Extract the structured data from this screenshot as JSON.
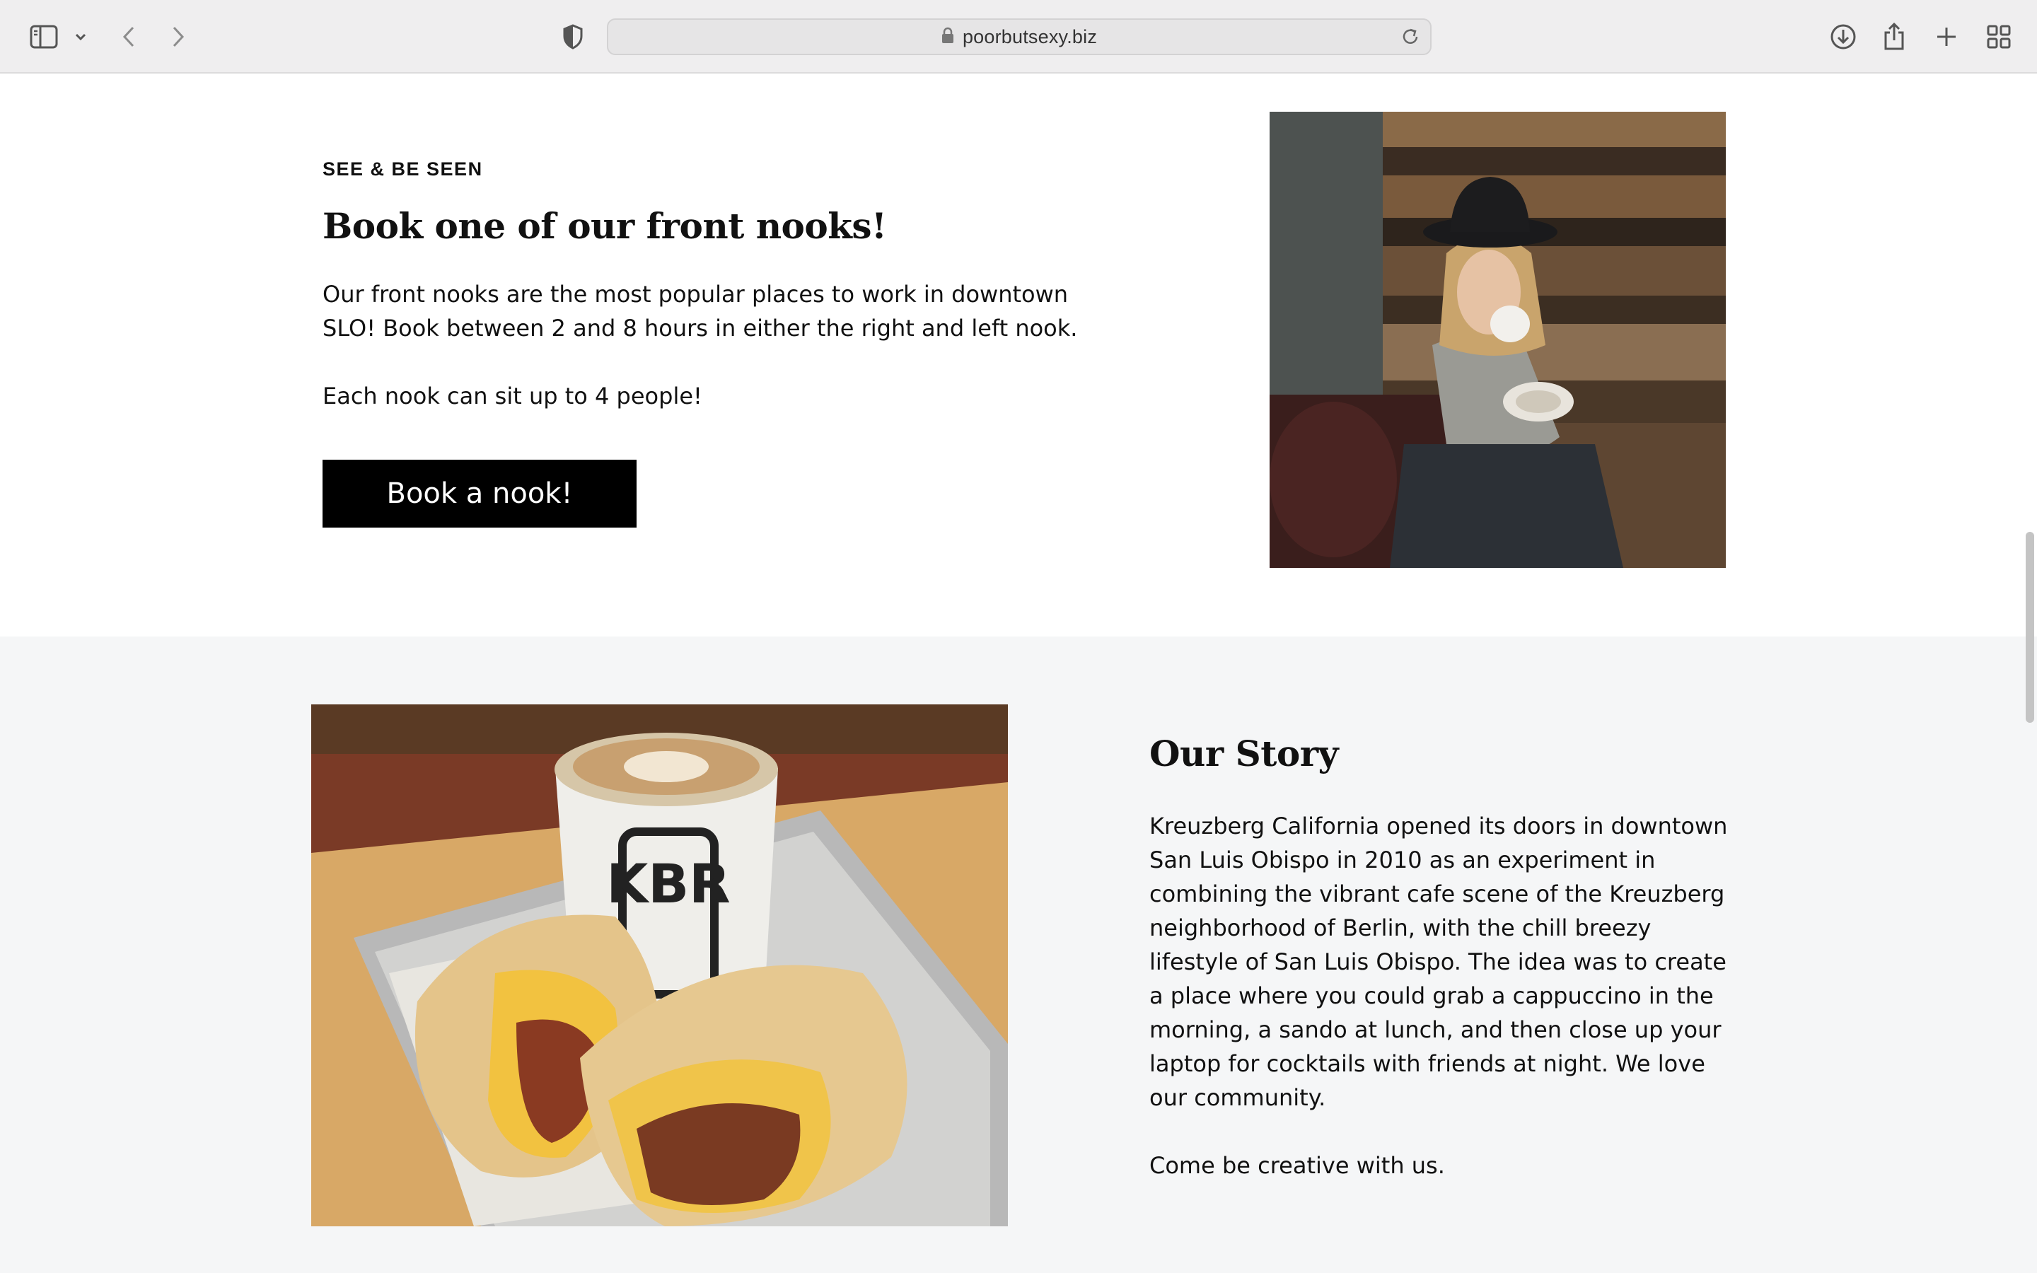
{
  "browser": {
    "url": "poorbutsexy.biz",
    "icons": {
      "sidebar": "sidebar-icon",
      "sidebar_menu": "chevron-down-icon",
      "back": "chevron-left-icon",
      "forward": "chevron-right-icon",
      "privacy": "shield-icon",
      "lock": "lock-icon",
      "reload": "reload-icon",
      "downloads": "download-icon",
      "share": "share-icon",
      "new_tab": "plus-icon",
      "tab_overview": "grid-icon"
    }
  },
  "nook_section": {
    "eyebrow": "SEE & BE SEEN",
    "heading": "Book one of our front nooks!",
    "paragraph1": "Our front nooks are the most popular places to work in downtown SLO! Book between 2 and 8 hours in either the right and left nook.",
    "paragraph2": "Each nook can sit up to 4 people!",
    "button_label": "Book a nook!",
    "image": "photo-woman-drinking-coffee"
  },
  "story_section": {
    "heading": "Our Story",
    "paragraph1": "Kreuzberg California opened its doors in downtown San Luis Obispo in 2010 as an experiment in combining the vibrant cafe scene of the Kreuzberg neighborhood of Berlin, with the chill breezy lifestyle of San Luis Obispo. The idea was to create a place where you could grab a cappuccino in the morning, a sando at lunch, and then close up your laptop for cocktails with friends at night. We love our community.",
    "paragraph2": "Come be creative with us.",
    "image": "photo-burrito-and-latte",
    "cup_lettering": "KBR"
  },
  "colors": {
    "toolbar_bg": "#efeeef",
    "page_bg": "#ffffff",
    "alt_section_bg": "#f5f6f7",
    "button_bg": "#000000",
    "button_text": "#ffffff",
    "text": "#111111"
  }
}
